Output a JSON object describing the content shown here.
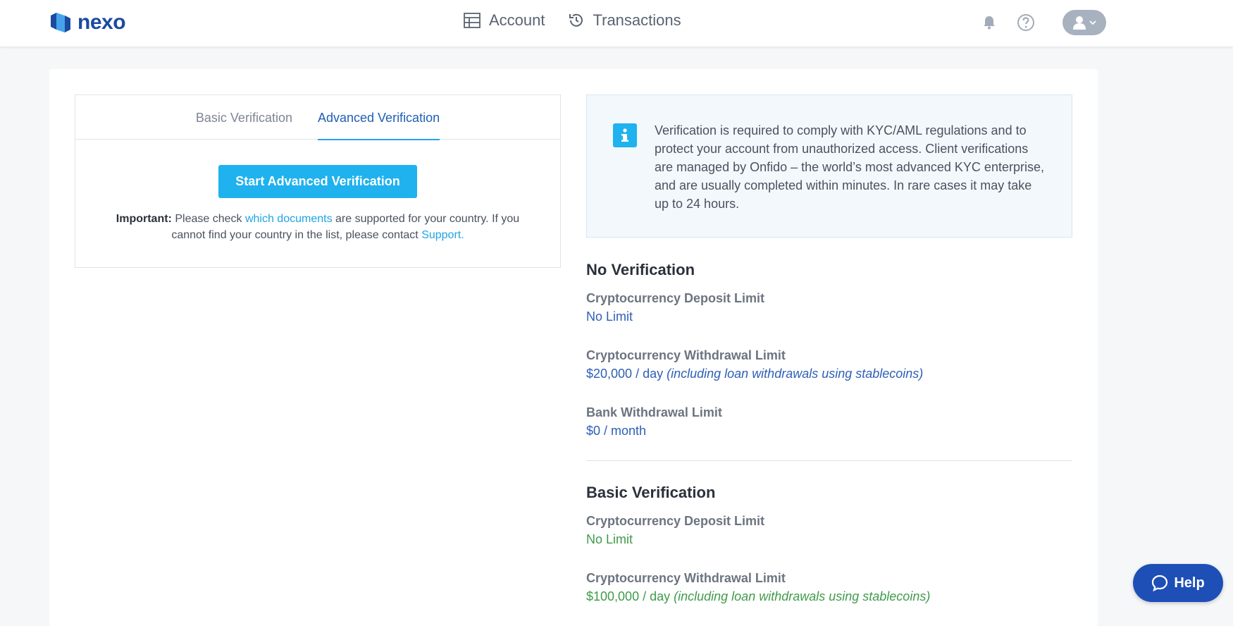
{
  "brand": {
    "name": "nexo",
    "color": "#1a4ba0"
  },
  "nav": {
    "items": [
      {
        "label": "Account",
        "icon": "table-icon"
      },
      {
        "label": "Transactions",
        "icon": "history-icon"
      }
    ]
  },
  "topbar": {
    "icons": [
      "bell-icon",
      "question-icon",
      "user-avatar-icon",
      "chevron-down-icon"
    ]
  },
  "verification": {
    "tabs": [
      {
        "label": "Basic Verification",
        "active": false
      },
      {
        "label": "Advanced Verification",
        "active": true
      }
    ],
    "start_button_label": "Start Advanced Verification",
    "important_label": "Important:",
    "important_text_1": " Please check ",
    "documents_link": "which documents",
    "important_text_2": " are supported for your country. If you cannot find your country in the list, please contact ",
    "support_link": "Support",
    "important_text_3": "."
  },
  "info": {
    "text": "Verification is required to comply with KYC/AML regulations and to protect your account from unauthorized access. Client verifications are managed by Onfido – the world’s most advanced KYC enterprise, and are usually completed within minutes. In rare cases it may take up to 24 hours."
  },
  "limits": {
    "no_verification": {
      "title": "No Verification",
      "rows": [
        {
          "label": "Cryptocurrency Deposit Limit",
          "value": "No Limit",
          "note": ""
        },
        {
          "label": "Cryptocurrency Withdrawal Limit",
          "value": "$20,000 / day",
          "note": "(including loan withdrawals using stablecoins)"
        },
        {
          "label": "Bank Withdrawal Limit",
          "value": "$0 / month",
          "note": ""
        }
      ]
    },
    "basic_verification": {
      "title": "Basic Verification",
      "rows": [
        {
          "label": "Cryptocurrency Deposit Limit",
          "value": "No Limit",
          "note": ""
        },
        {
          "label": "Cryptocurrency Withdrawal Limit",
          "value": "$100,000 / day",
          "note": "(including loan withdrawals using stablecoins)"
        }
      ]
    }
  },
  "help": {
    "label": "Help"
  },
  "colors": {
    "accent": "#1fb2ee",
    "link": "#1fa4e4",
    "value_blue": "#2d5fb6",
    "value_green": "#3f9b4a",
    "help": "#1e4fb7"
  }
}
